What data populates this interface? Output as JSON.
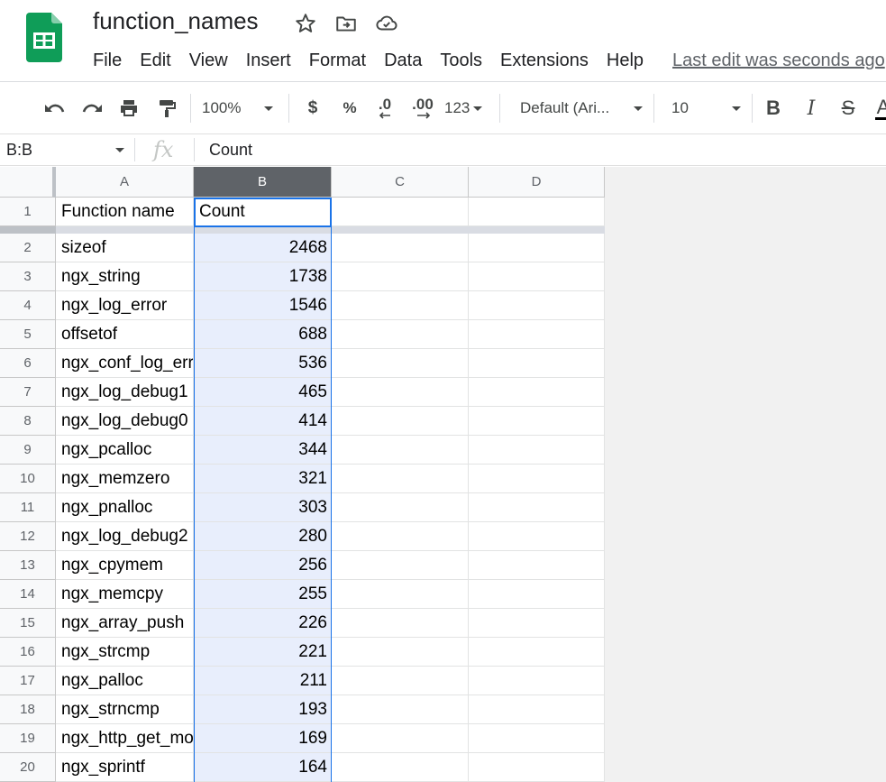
{
  "app": {
    "doc_title": "function_names",
    "menu": [
      "File",
      "Edit",
      "View",
      "Insert",
      "Format",
      "Data",
      "Tools",
      "Extensions",
      "Help"
    ],
    "last_edit": "Last edit was seconds ago",
    "brand_color": "#0f9d58"
  },
  "toolbar": {
    "zoom": "100%",
    "currency": "$",
    "percent": "%",
    "decrease_decimals": ".0",
    "increase_decimals": ".00",
    "more_formats": "123",
    "font": "Default (Ari...",
    "font_size": "10",
    "bold": "B",
    "italic": "I",
    "strikethrough": "S",
    "text_color": "A"
  },
  "formula_bar": {
    "name_box": "B:B",
    "fx": "fx",
    "content": "Count"
  },
  "sheet": {
    "columns": [
      "A",
      "B",
      "C",
      "D"
    ],
    "selected_column": "B",
    "rows": [
      {
        "n": "1",
        "a": "Function name",
        "b": "Count"
      },
      {
        "n": "2",
        "a": "sizeof",
        "b": "2468"
      },
      {
        "n": "3",
        "a": "ngx_string",
        "b": "1738"
      },
      {
        "n": "4",
        "a": "ngx_log_error",
        "b": "1546"
      },
      {
        "n": "5",
        "a": "offsetof",
        "b": "688"
      },
      {
        "n": "6",
        "a": "ngx_conf_log_error",
        "b": "536"
      },
      {
        "n": "7",
        "a": "ngx_log_debug1",
        "b": "465"
      },
      {
        "n": "8",
        "a": "ngx_log_debug0",
        "b": "414"
      },
      {
        "n": "9",
        "a": "ngx_pcalloc",
        "b": "344"
      },
      {
        "n": "10",
        "a": "ngx_memzero",
        "b": "321"
      },
      {
        "n": "11",
        "a": "ngx_pnalloc",
        "b": "303"
      },
      {
        "n": "12",
        "a": "ngx_log_debug2",
        "b": "280"
      },
      {
        "n": "13",
        "a": "ngx_cpymem",
        "b": "256"
      },
      {
        "n": "14",
        "a": "ngx_memcpy",
        "b": "255"
      },
      {
        "n": "15",
        "a": "ngx_array_push",
        "b": "226"
      },
      {
        "n": "16",
        "a": "ngx_strcmp",
        "b": "221"
      },
      {
        "n": "17",
        "a": "ngx_palloc",
        "b": "211"
      },
      {
        "n": "18",
        "a": "ngx_strncmp",
        "b": "193"
      },
      {
        "n": "19",
        "a": "ngx_http_get_module_ctx",
        "b": "169"
      },
      {
        "n": "20",
        "a": "ngx_sprintf",
        "b": "164"
      }
    ]
  }
}
